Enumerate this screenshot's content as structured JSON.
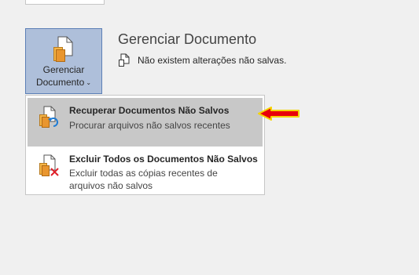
{
  "manage_button": {
    "line1": "Gerenciar",
    "line2": "Documento",
    "chevron": "⌄",
    "icon": "document-stack-icon"
  },
  "section": {
    "title": "Gerenciar Documento",
    "status_text": "Não existem alterações não salvas.",
    "status_icon": "document-status-icon"
  },
  "dropdown": {
    "items": [
      {
        "title": "Recuperar Documentos Não Salvos",
        "description": "Procurar arquivos não salvos recentes",
        "icon": "recover-document-icon",
        "selected": true
      },
      {
        "title": "Excluir Todos os Documentos Não Salvos",
        "description": "Excluir todas as cópias recentes de arquivos não salvos",
        "icon": "delete-document-icon",
        "selected": false
      }
    ]
  },
  "colors": {
    "button_bg": "#aebfda",
    "button_border": "#5c7fb6",
    "selected_item_bg": "#c8c8c8",
    "arrow_fill": "#e8000b",
    "arrow_outline": "#f5d400"
  }
}
